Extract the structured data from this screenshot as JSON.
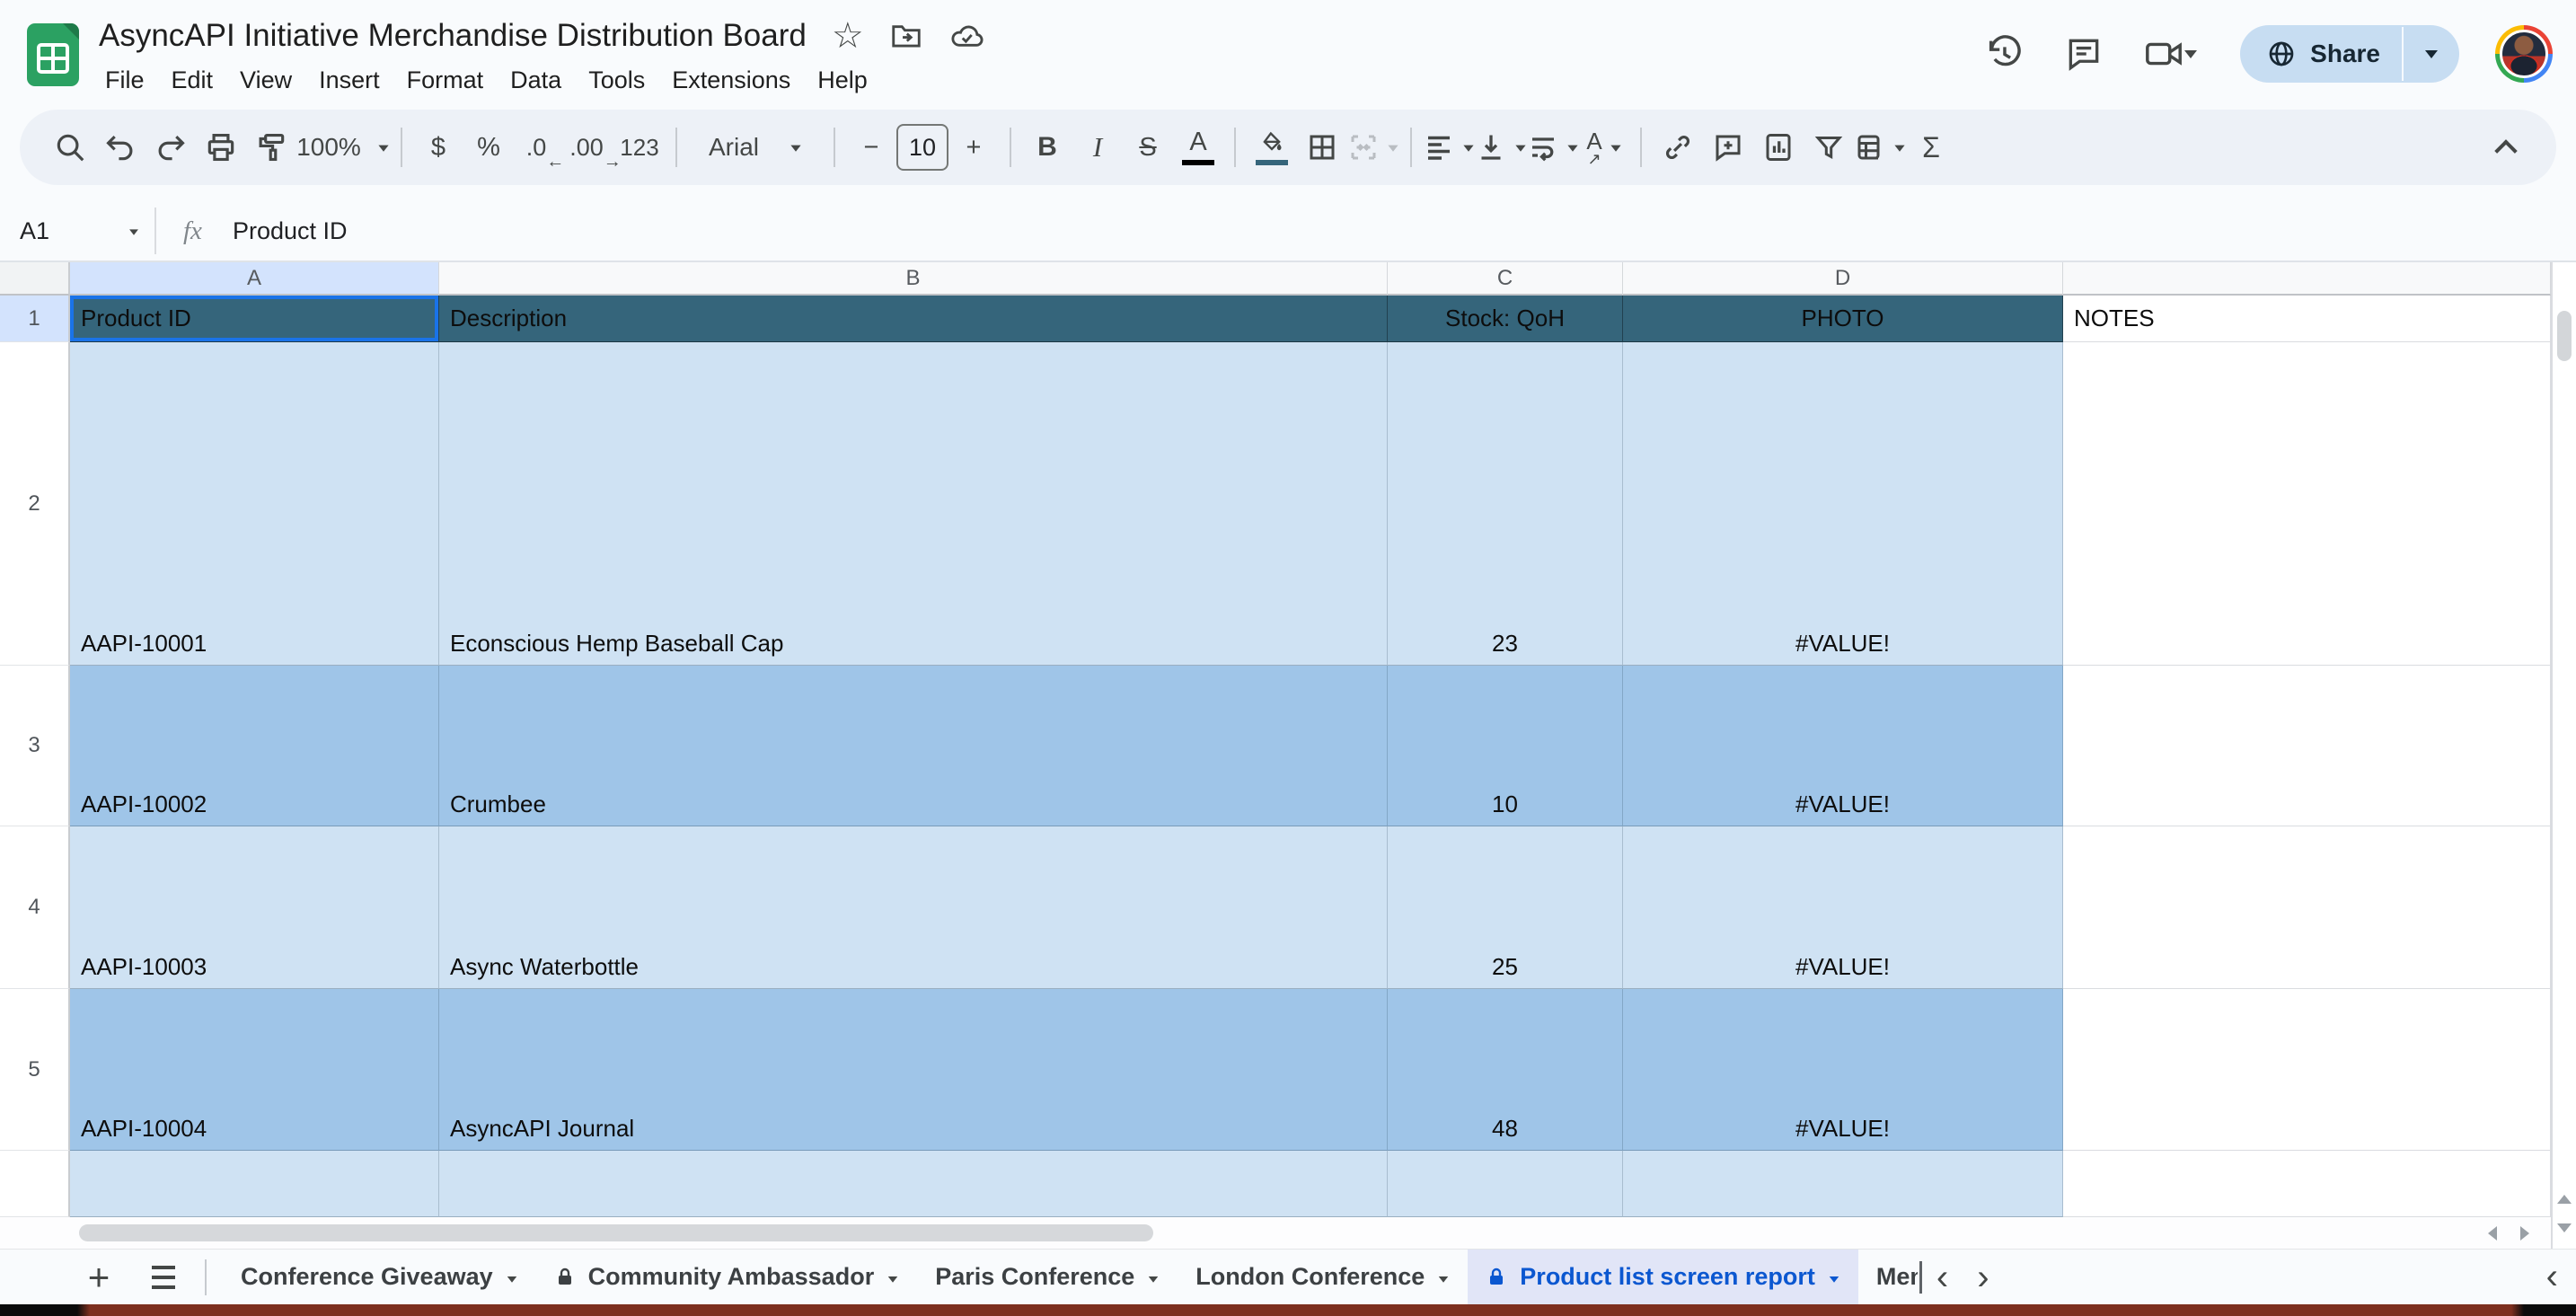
{
  "header": {
    "title": "AsyncAPI Initiative Merchandise Distribution Board",
    "menus": [
      "File",
      "Edit",
      "View",
      "Insert",
      "Format",
      "Data",
      "Tools",
      "Extensions",
      "Help"
    ],
    "share_label": "Share"
  },
  "toolbar": {
    "zoom_value": "100%",
    "dollar": "$",
    "percent": "%",
    "decimal_decrease": ".0",
    "decimal_decrease_arrow": "←",
    "decimal_increase": ".00",
    "decimal_increase_arrow": "→",
    "custom_format": "123",
    "font_name": "Arial",
    "minus": "−",
    "font_size": "10",
    "plus": "+",
    "bold": "B",
    "italic": "I",
    "strikethrough": "S",
    "text_color": "A",
    "rotate_letter": "A",
    "rotate_arrow": "↗",
    "functions": "Σ"
  },
  "formula_bar": {
    "cell_ref": "A1",
    "fx": "fx",
    "value": "Product ID"
  },
  "grid": {
    "column_letters": [
      "A",
      "B",
      "C",
      "D"
    ],
    "rows": [
      {
        "num": "1",
        "cells": [
          "Product ID",
          "Description",
          "Stock: QoH",
          "PHOTO"
        ],
        "notes": "NOTES"
      },
      {
        "num": "2",
        "cells": [
          "AAPI-10001",
          "Econscious Hemp Baseball Cap",
          "23",
          "#VALUE!"
        ]
      },
      {
        "num": "3",
        "cells": [
          "AAPI-10002",
          "Crumbee",
          "10",
          "#VALUE!"
        ]
      },
      {
        "num": "4",
        "cells": [
          "AAPI-10003",
          "Async Waterbottle",
          "25",
          "#VALUE!"
        ]
      },
      {
        "num": "5",
        "cells": [
          "AAPI-10004",
          "AsyncAPI Journal",
          "48",
          "#VALUE!"
        ]
      }
    ]
  },
  "sheet_tabs": {
    "add": "+",
    "items": [
      {
        "label": "Conference Giveaway",
        "locked": false,
        "active": false
      },
      {
        "label": "Community Ambassador",
        "locked": true,
        "active": false
      },
      {
        "label": "Paris Conference",
        "locked": false,
        "active": false
      },
      {
        "label": "London Conference",
        "locked": false,
        "active": false
      },
      {
        "label": "Product list screen report",
        "locked": true,
        "active": true
      },
      {
        "label": "Ment",
        "locked": false,
        "active": false
      }
    ],
    "prev": "‹",
    "next": "›",
    "panel_collapse": "‹"
  },
  "colors": {
    "table_header_fill": "#35657b",
    "band_light": "#cfe2f3",
    "band_dark": "#9fc5e8",
    "selection_blue": "#1a73e8",
    "selected_header": "#d3e3fd",
    "active_tab_bg": "#e1e5f7",
    "active_tab_text": "#0b57d0",
    "share_pill": "#c7ddf2"
  }
}
